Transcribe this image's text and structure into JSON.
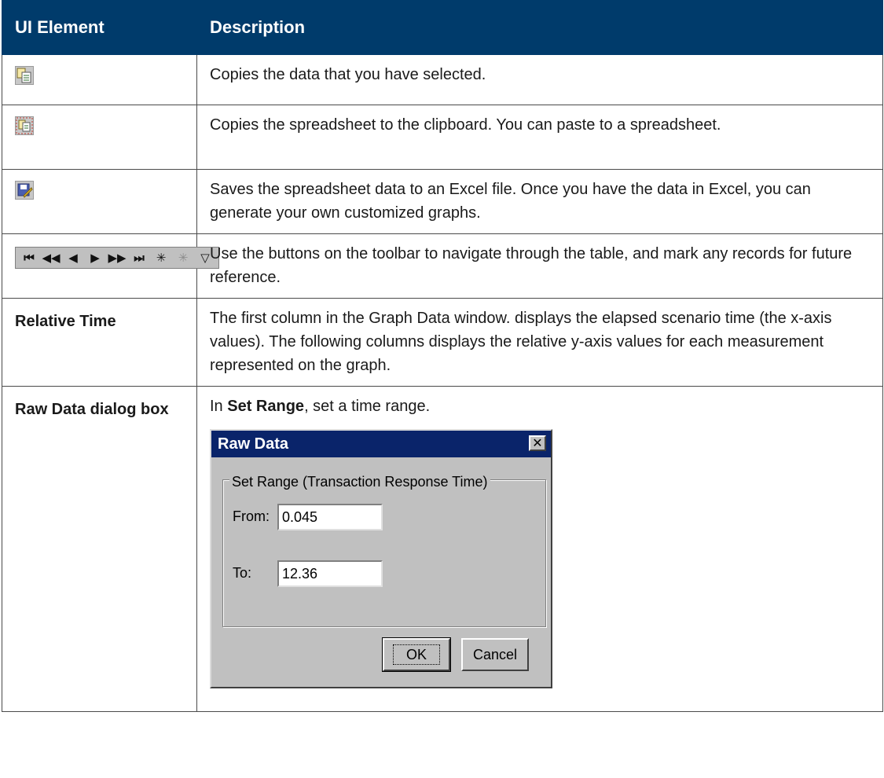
{
  "header": {
    "col1": "UI Element",
    "col2": "Description"
  },
  "rows": [
    {
      "icon": "copy-selected-icon",
      "description": "Copies the data that you have selected."
    },
    {
      "icon": "copy-spreadsheet-icon",
      "description": "Copies the spreadsheet to the clipboard. You can paste to a spreadsheet."
    },
    {
      "icon": "save-excel-icon",
      "description": "Saves the spreadsheet data to an Excel file. Once you have the data in Excel, you can generate your own customized graphs."
    },
    {
      "icon": "navigation-toolbar-icon",
      "description": "Use the buttons on the toolbar to navigate through the table, and mark any records for future reference."
    },
    {
      "element": "Relative Time",
      "description": "The first column in the Graph Data window. displays the elapsed scenario time (the x-axis values). The following columns displays the relative y-axis values for each measurement represented on the graph."
    },
    {
      "element": "Raw Data dialog box",
      "desc_prefix": "In ",
      "desc_bold": "Set Range",
      "desc_suffix": ", set a time range."
    }
  ],
  "nav_buttons": [
    "⏮",
    "◀◀",
    "◀",
    "▶",
    "▶▶",
    "⏭",
    "✳",
    "✳",
    "▽"
  ],
  "dialog": {
    "title": "Raw Data",
    "group_label": "Set Range  (Transaction Response Time)",
    "from_label": "From:",
    "from_value": "0.045",
    "to_label": "To:",
    "to_value": "12.36",
    "ok_label": "OK",
    "cancel_label": "Cancel"
  },
  "colors": {
    "header_bg": "#003b6b",
    "dialog_title_bg": "#0a246a"
  }
}
